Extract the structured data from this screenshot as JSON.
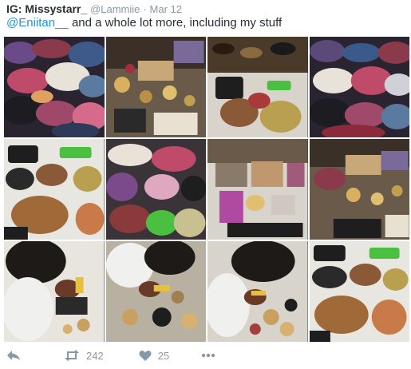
{
  "tweet": {
    "name": "IG: Missystarr_",
    "handle": "@Lammiie",
    "separator": "·",
    "date": "Mar 12",
    "mention": "@Eniitan__",
    "text": " and a whole lot more, including my stuff"
  },
  "photos": [
    {
      "label": "pile of clothes"
    },
    {
      "label": "jewelry and makeup on table"
    },
    {
      "label": "shoes and handbags"
    },
    {
      "label": "pile of clothes"
    },
    {
      "label": "handbags"
    },
    {
      "label": "clothes and handbags"
    },
    {
      "label": "makeup palettes and brushes"
    },
    {
      "label": "jewelry and makeup on table"
    },
    {
      "label": "woman sorting jewelry"
    },
    {
      "label": "woman sorting jewelry"
    },
    {
      "label": "woman sorting jewelry"
    },
    {
      "label": "handbags"
    }
  ],
  "actions": {
    "retweets": "242",
    "likes": "25"
  },
  "colors": {
    "link": "#1b95e0",
    "muted": "#8899a6",
    "text": "#292f33"
  }
}
